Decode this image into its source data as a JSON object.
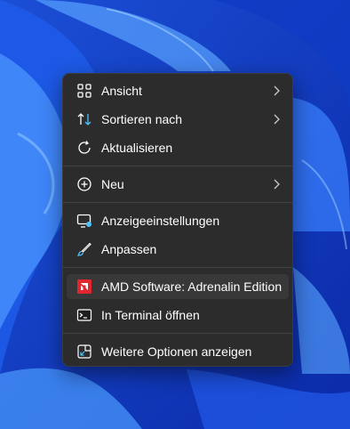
{
  "wallpaper": {
    "color": "#2a6fe6"
  },
  "menu": {
    "items": [
      {
        "label": "Ansicht",
        "icon": "grid-icon",
        "submenu": true
      },
      {
        "label": "Sortieren nach",
        "icon": "sort-arrows-icon",
        "submenu": true
      },
      {
        "label": "Aktualisieren",
        "icon": "refresh-icon",
        "submenu": false
      },
      {
        "label": "Neu",
        "icon": "plus-circle-icon",
        "submenu": true
      },
      {
        "label": "Anzeigeeinstellungen",
        "icon": "display-settings-icon",
        "submenu": false
      },
      {
        "label": "Anpassen",
        "icon": "paintbrush-icon",
        "submenu": false
      },
      {
        "label": "AMD Software: Adrenalin Edition",
        "icon": "amd-logo-icon",
        "submenu": false,
        "highlighted": true
      },
      {
        "label": "In Terminal öffnen",
        "icon": "terminal-icon",
        "submenu": false
      },
      {
        "label": "Weitere Optionen anzeigen",
        "icon": "more-options-icon",
        "submenu": false
      }
    ]
  },
  "colors": {
    "menu_bg": "#2c2c2c",
    "highlight_bg": "#383838",
    "amd_red": "#e0262f",
    "accent": "#4cc2ff"
  }
}
